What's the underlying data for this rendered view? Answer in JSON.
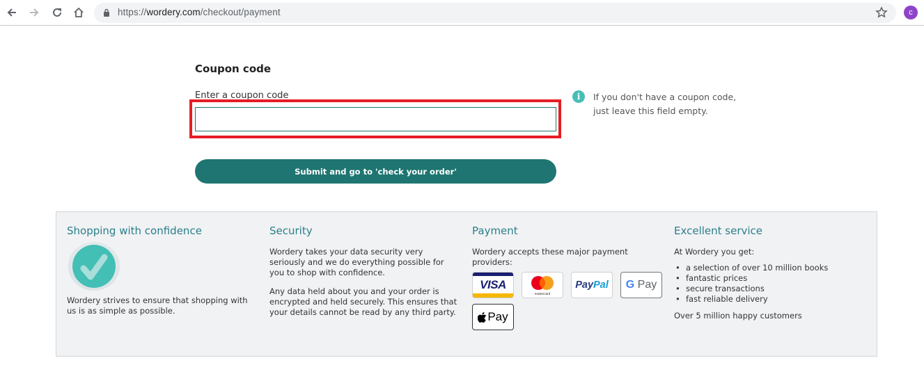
{
  "browser": {
    "url_scheme": "https://",
    "url_host": "wordery.com",
    "url_path": "/checkout/payment",
    "avatar_letter": "c"
  },
  "coupon": {
    "title": "Coupon code",
    "label": "Enter a coupon code",
    "value": "",
    "placeholder": "",
    "info_text": "If you don't have a coupon code, just leave this field empty.",
    "submit_label": "Submit and go to 'check your order'"
  },
  "footer": {
    "confidence": {
      "title": "Shopping with confidence",
      "text": "Wordery strives to ensure that shopping with us is as simple as possible."
    },
    "security": {
      "title": "Security",
      "paragraphs": [
        "Wordery takes your data security very seriously and we do everything possible for you to shop with confidence.",
        "Any data held about you and your order is encrypted and held securely. This ensures that your details cannot be read by any third party."
      ]
    },
    "payment": {
      "title": "Payment",
      "text": "Wordery accepts these major payment providers:",
      "providers": [
        "VISA",
        "mastercard",
        "PayPal",
        "G Pay",
        "Pay"
      ]
    },
    "service": {
      "title": "Excellent service",
      "intro": "At Wordery you get:",
      "items": [
        "a selection of over 10 million books",
        "fantastic prices",
        "secure transactions",
        "fast reliable delivery"
      ],
      "closing": "Over 5 million happy customers"
    }
  },
  "colors": {
    "brand_teal": "#1f7571",
    "heading_teal": "#2a7f8a",
    "highlight_red": "#e61d26",
    "info_teal": "#47bfb8"
  }
}
